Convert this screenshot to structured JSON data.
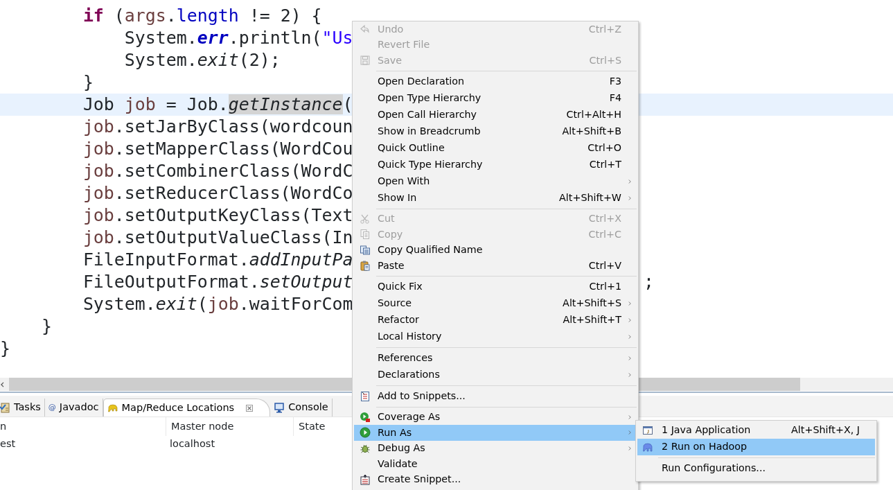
{
  "editor": {
    "lines": [
      {
        "current": false,
        "tokens": [
          {
            "kind": "keyword",
            "text": "        if"
          },
          {
            "kind": "plain",
            "text": " ("
          },
          {
            "kind": "local",
            "text": "args"
          },
          {
            "kind": "plain",
            "text": "."
          },
          {
            "kind": "field",
            "text": "length"
          },
          {
            "kind": "plain",
            "text": " != 2) {"
          }
        ]
      },
      {
        "current": false,
        "tokens": [
          {
            "kind": "plain",
            "text": "            System."
          },
          {
            "kind": "static-field",
            "text": "err"
          },
          {
            "kind": "plain",
            "text": ".println("
          },
          {
            "kind": "string",
            "text": "\"Us"
          }
        ]
      },
      {
        "current": false,
        "tokens": [
          {
            "kind": "plain",
            "text": "            System."
          },
          {
            "kind": "static-method",
            "text": "exit"
          },
          {
            "kind": "plain",
            "text": "(2);"
          }
        ]
      },
      {
        "current": false,
        "tokens": [
          {
            "kind": "plain",
            "text": "        }"
          }
        ]
      },
      {
        "current": true,
        "tokens": [
          {
            "kind": "plain",
            "text": "        Job ",
            "marked": false
          },
          {
            "kind": "local",
            "text": "job",
            "marked": false
          },
          {
            "kind": "plain",
            "text": " = Job.",
            "marked": false
          },
          {
            "kind": "static-method",
            "text": "getInstance",
            "marked": true
          },
          {
            "kind": "plain",
            "text": "(",
            "marked": false
          }
        ]
      },
      {
        "current": false,
        "tokens": [
          {
            "kind": "local",
            "text": "        job"
          },
          {
            "kind": "plain",
            "text": ".setJarByClass(wordcoun"
          }
        ]
      },
      {
        "current": false,
        "tokens": [
          {
            "kind": "local",
            "text": "        job"
          },
          {
            "kind": "plain",
            "text": ".setMapperClass(WordCou"
          }
        ]
      },
      {
        "current": false,
        "tokens": [
          {
            "kind": "local",
            "text": "        job"
          },
          {
            "kind": "plain",
            "text": ".setCombinerClass(WordC"
          }
        ]
      },
      {
        "current": false,
        "tokens": [
          {
            "kind": "local",
            "text": "        job"
          },
          {
            "kind": "plain",
            "text": ".setReducerClass(WordCo"
          }
        ]
      },
      {
        "current": false,
        "tokens": [
          {
            "kind": "local",
            "text": "        job"
          },
          {
            "kind": "plain",
            "text": ".setOutputKeyClass(Text"
          }
        ]
      },
      {
        "current": false,
        "tokens": [
          {
            "kind": "local",
            "text": "        job"
          },
          {
            "kind": "plain",
            "text": ".setOutputValueClass(In"
          }
        ]
      },
      {
        "current": false,
        "tokens": [
          {
            "kind": "plain",
            "text": "        FileInputFormat."
          },
          {
            "kind": "static-method",
            "text": "addInputPa"
          }
        ]
      },
      {
        "current": false,
        "tokens": [
          {
            "kind": "plain",
            "text": "        FileOutputFormat."
          },
          {
            "kind": "static-method",
            "text": "setOutput"
          }
        ],
        "tail": ";"
      },
      {
        "current": false,
        "tokens": [
          {
            "kind": "plain",
            "text": "        System."
          },
          {
            "kind": "static-method",
            "text": "exit"
          },
          {
            "kind": "plain",
            "text": "("
          },
          {
            "kind": "local",
            "text": "job"
          },
          {
            "kind": "plain",
            "text": ".waitForCom"
          }
        ]
      },
      {
        "current": false,
        "tokens": [
          {
            "kind": "plain",
            "text": "    }"
          }
        ]
      },
      {
        "current": false,
        "tokens": [
          {
            "kind": "plain",
            "text": "}"
          }
        ]
      }
    ]
  },
  "bottom_panel": {
    "tabs": [
      {
        "label": "Tasks",
        "selected": false
      },
      {
        "label": "Javadoc",
        "selected": false,
        "glyph": "@"
      },
      {
        "label": "Map/Reduce Locations",
        "selected": true
      },
      {
        "label": "Console",
        "selected": false
      }
    ],
    "table": {
      "columns": [
        "n",
        "Master node",
        "State"
      ],
      "rows": [
        {
          "cells": [
            "est",
            "localhost"
          ]
        }
      ]
    }
  },
  "context_menu": {
    "sections": [
      {
        "items": [
          {
            "label": "Undo",
            "shortcut": "Ctrl+Z",
            "disabled": true,
            "submenu": false,
            "selected": false
          },
          {
            "label": "Revert File",
            "disabled": true,
            "submenu": false,
            "selected": false
          },
          {
            "label": "Save",
            "shortcut": "Ctrl+S",
            "disabled": true,
            "submenu": false,
            "selected": false
          }
        ]
      },
      {
        "items": [
          {
            "label": "Open Declaration",
            "shortcut": "F3",
            "disabled": false,
            "submenu": false,
            "selected": false
          },
          {
            "label": "Open Type Hierarchy",
            "shortcut": "F4",
            "disabled": false,
            "submenu": false,
            "selected": false
          },
          {
            "label": "Open Call Hierarchy",
            "shortcut": "Ctrl+Alt+H",
            "disabled": false,
            "submenu": false,
            "selected": false
          },
          {
            "label": "Show in Breadcrumb",
            "shortcut": "Alt+Shift+B",
            "disabled": false,
            "submenu": false,
            "selected": false
          },
          {
            "label": "Quick Outline",
            "shortcut": "Ctrl+O",
            "disabled": false,
            "submenu": false,
            "selected": false
          },
          {
            "label": "Quick Type Hierarchy",
            "shortcut": "Ctrl+T",
            "disabled": false,
            "submenu": false,
            "selected": false
          },
          {
            "label": "Open With",
            "disabled": false,
            "submenu": true,
            "selected": false
          },
          {
            "label": "Show In",
            "shortcut": "Alt+Shift+W",
            "disabled": false,
            "submenu": true,
            "selected": false
          }
        ]
      },
      {
        "items": [
          {
            "label": "Cut",
            "shortcut": "Ctrl+X",
            "disabled": true,
            "submenu": false,
            "selected": false
          },
          {
            "label": "Copy",
            "shortcut": "Ctrl+C",
            "disabled": true,
            "submenu": false,
            "selected": false
          },
          {
            "label": "Copy Qualified Name",
            "disabled": false,
            "submenu": false,
            "selected": false
          },
          {
            "label": "Paste",
            "shortcut": "Ctrl+V",
            "disabled": false,
            "submenu": false,
            "selected": false
          }
        ]
      },
      {
        "items": [
          {
            "label": "Quick Fix",
            "shortcut": "Ctrl+1",
            "disabled": false,
            "submenu": false,
            "selected": false
          },
          {
            "label": "Source",
            "shortcut": "Alt+Shift+S",
            "disabled": false,
            "submenu": true,
            "selected": false
          },
          {
            "label": "Refactor",
            "shortcut": "Alt+Shift+T",
            "disabled": false,
            "submenu": true,
            "selected": false
          },
          {
            "label": "Local History",
            "disabled": false,
            "submenu": true,
            "selected": false
          }
        ]
      },
      {
        "items": [
          {
            "label": "References",
            "disabled": false,
            "submenu": true,
            "selected": false
          },
          {
            "label": "Declarations",
            "disabled": false,
            "submenu": true,
            "selected": false
          }
        ]
      },
      {
        "items": [
          {
            "label": "Add to Snippets...",
            "disabled": false,
            "submenu": false,
            "selected": false
          }
        ]
      },
      {
        "items": [
          {
            "label": "Coverage As",
            "disabled": false,
            "submenu": true,
            "selected": false
          },
          {
            "label": "Run As",
            "disabled": false,
            "submenu": true,
            "selected": true
          },
          {
            "label": "Debug As",
            "disabled": false,
            "submenu": true,
            "selected": false
          },
          {
            "label": "Validate",
            "disabled": false,
            "submenu": false,
            "selected": false
          },
          {
            "label": "Create Snippet...",
            "disabled": false,
            "submenu": false,
            "selected": false
          }
        ]
      }
    ]
  },
  "run_as_submenu": {
    "sections": [
      {
        "items": [
          {
            "label": "1 Java Application",
            "shortcut": "Alt+Shift+X, J",
            "selected": false
          },
          {
            "label": "2 Run on Hadoop",
            "selected": true
          }
        ]
      },
      {
        "items": [
          {
            "label": "Run Configurations...",
            "selected": false
          }
        ]
      }
    ]
  }
}
